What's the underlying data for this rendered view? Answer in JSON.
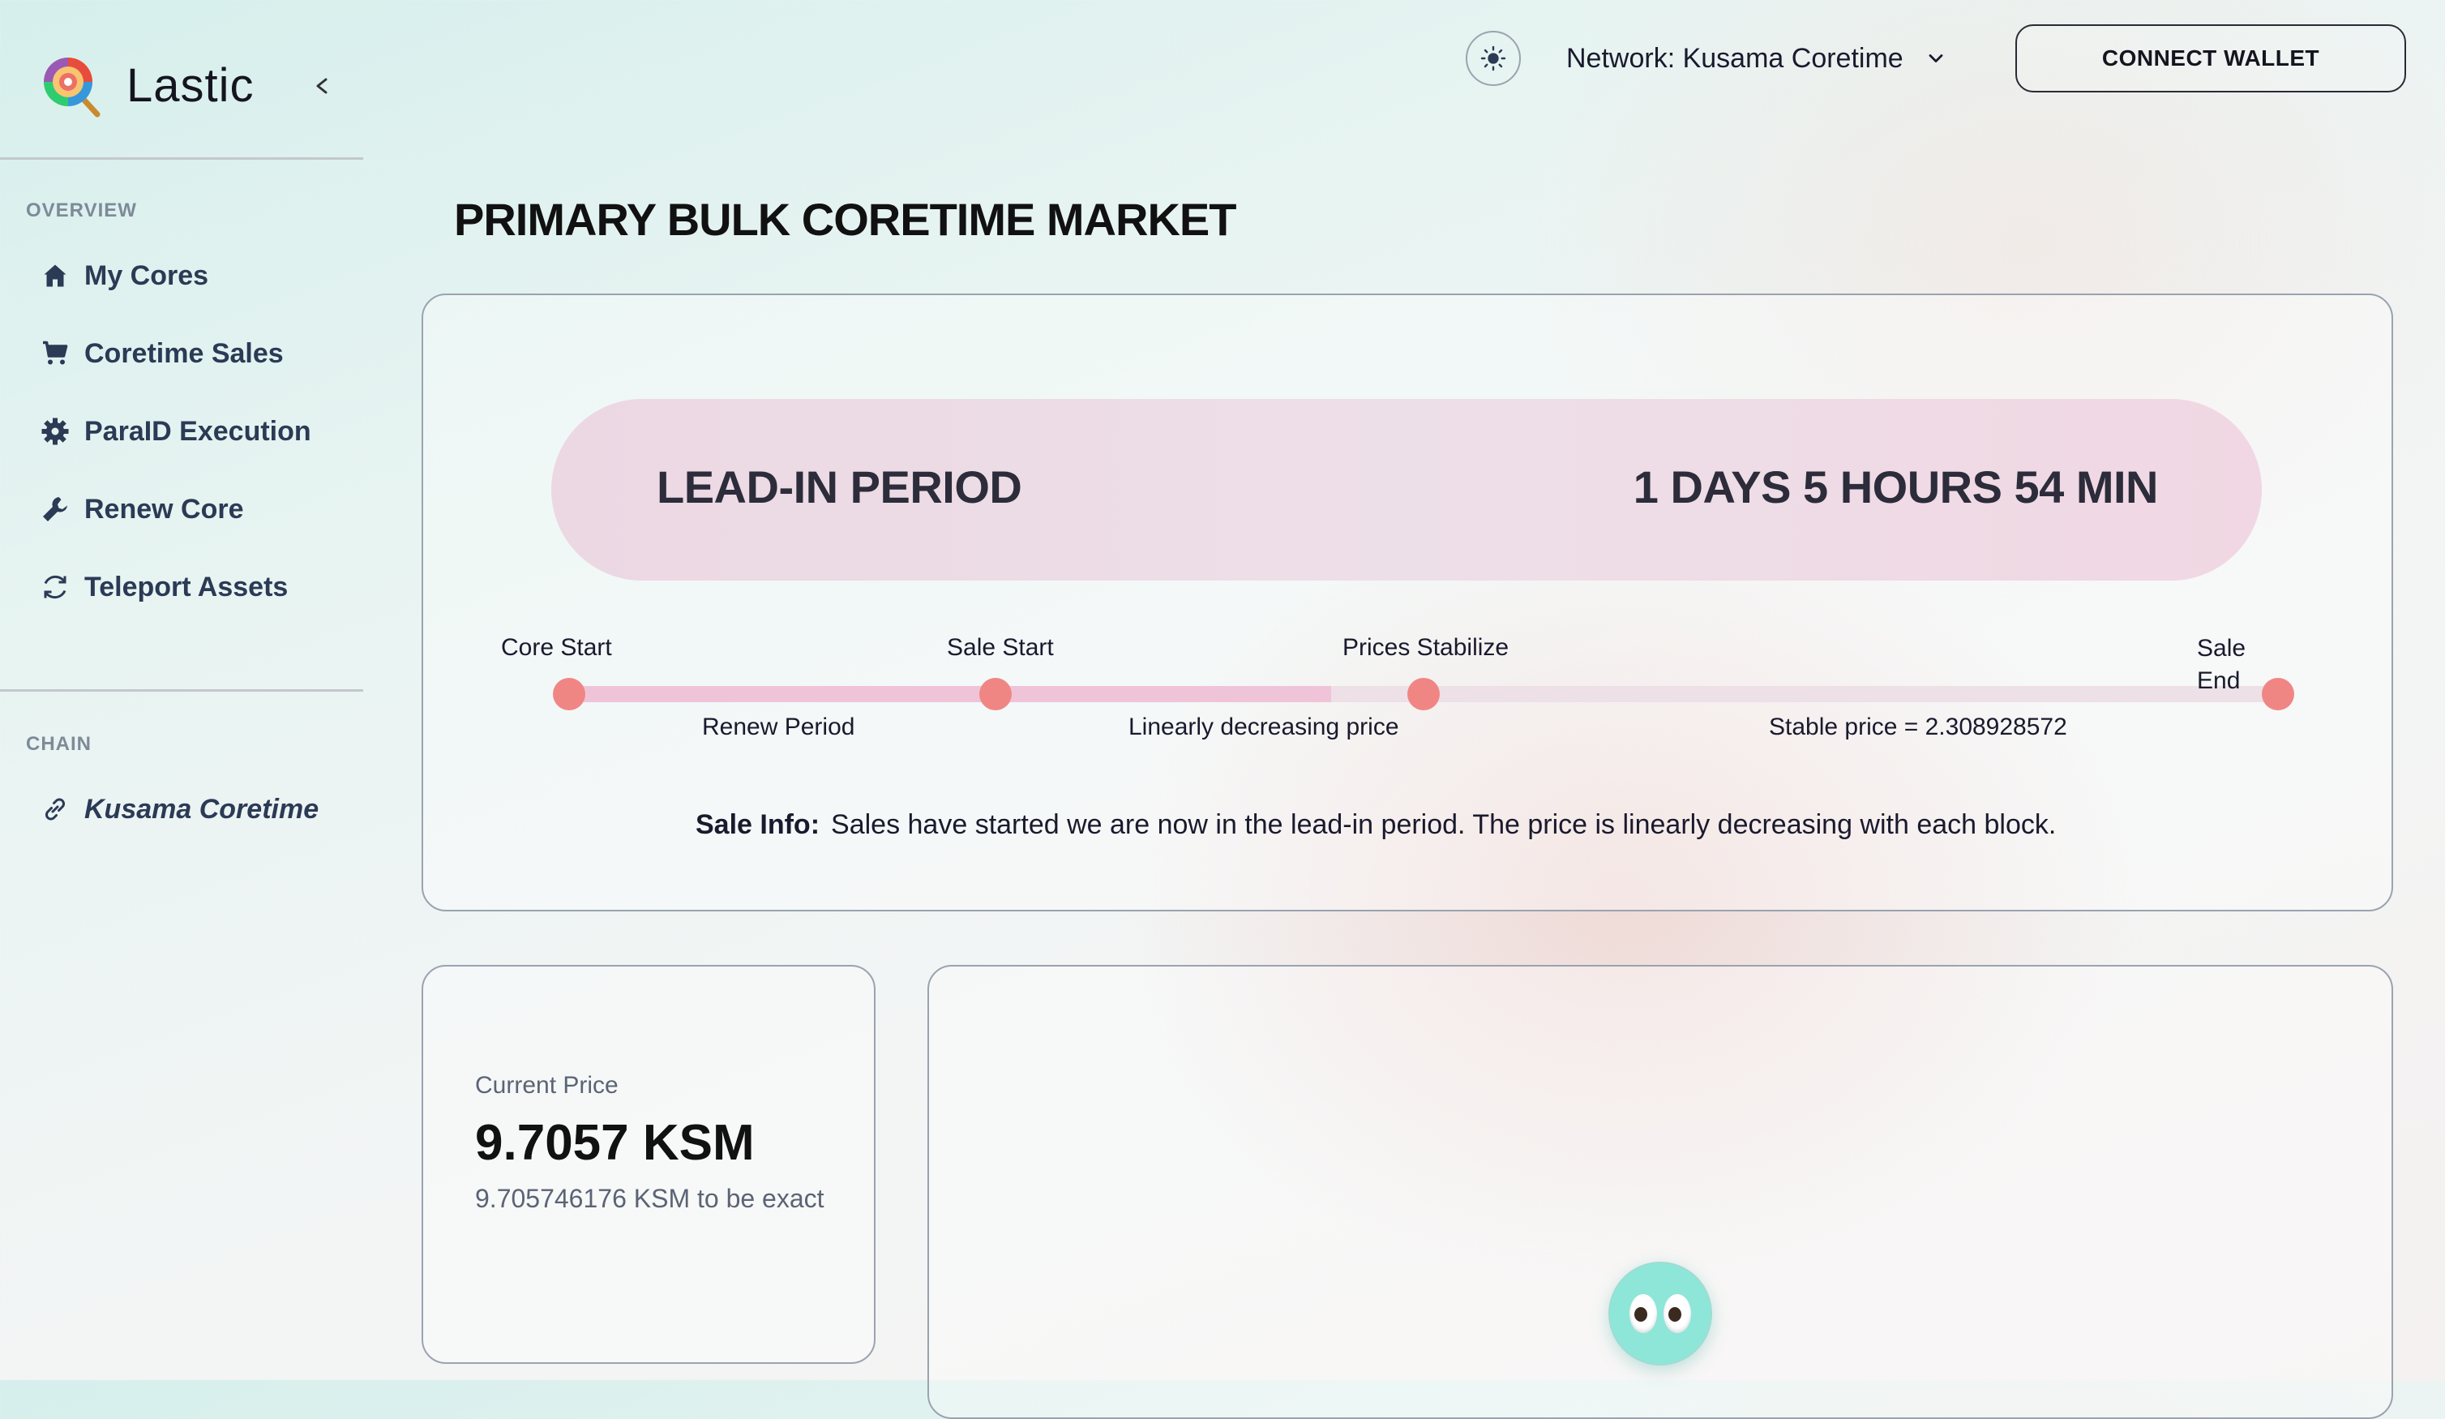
{
  "app": {
    "name": "Lastic"
  },
  "sidebar": {
    "overview_label": "OVERVIEW",
    "items": [
      {
        "label": "My Cores",
        "icon": "home-icon"
      },
      {
        "label": "Coretime Sales",
        "icon": "cart-icon"
      },
      {
        "label": "ParaID Execution",
        "icon": "gear-icon"
      },
      {
        "label": "Renew Core",
        "icon": "wrench-icon"
      },
      {
        "label": "Teleport Assets",
        "icon": "refresh-icon"
      }
    ],
    "chain_label": "CHAIN",
    "chain_item": {
      "label": "Kusama Coretime",
      "icon": "link-icon"
    }
  },
  "header": {
    "network_label": "Network: Kusama Coretime",
    "connect_label": "CONNECT WALLET"
  },
  "page": {
    "title": "PRIMARY BULK CORETIME MARKET"
  },
  "period": {
    "name": "LEAD-IN PERIOD",
    "time_left": "1 DAYS 5 HOURS 54 MIN"
  },
  "timeline": {
    "milestones": [
      "Core Start",
      "Sale Start",
      "Prices Stabilize",
      "Sale End"
    ],
    "segments": [
      "Renew Period",
      "Linearly decreasing price",
      "Stable price = 2.308928572"
    ]
  },
  "sale_info": {
    "label": "Sale Info:",
    "text": "Sales have started we are now in the lead-in period. The price is linearly decreasing with each block."
  },
  "price": {
    "label": "Current Price",
    "value": "9.7057 KSM",
    "exact": "9.705746176 KSM to be exact"
  },
  "colors": {
    "accent_dot": "#f08684",
    "progress_fill": "#efc4d9",
    "pill": "#eddfe8"
  }
}
